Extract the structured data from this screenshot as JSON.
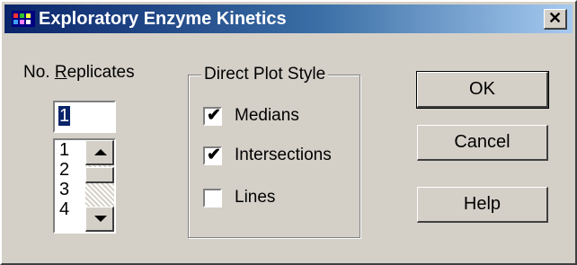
{
  "window": {
    "title": "Exploratory Enzyme Kinetics",
    "close_label": "✕"
  },
  "replicates": {
    "label": "No. Replicates",
    "label_mnemonic_index": 4,
    "value": "1",
    "list_items": [
      "1",
      "2",
      "3",
      "4"
    ]
  },
  "plot_style": {
    "legend": "Direct Plot Style",
    "options": [
      {
        "label": "Medians",
        "checked": true
      },
      {
        "label": "Intersections",
        "checked": true
      },
      {
        "label": "Lines",
        "checked": false
      }
    ]
  },
  "buttons": {
    "ok": "OK",
    "cancel": "Cancel",
    "help": "Help"
  }
}
